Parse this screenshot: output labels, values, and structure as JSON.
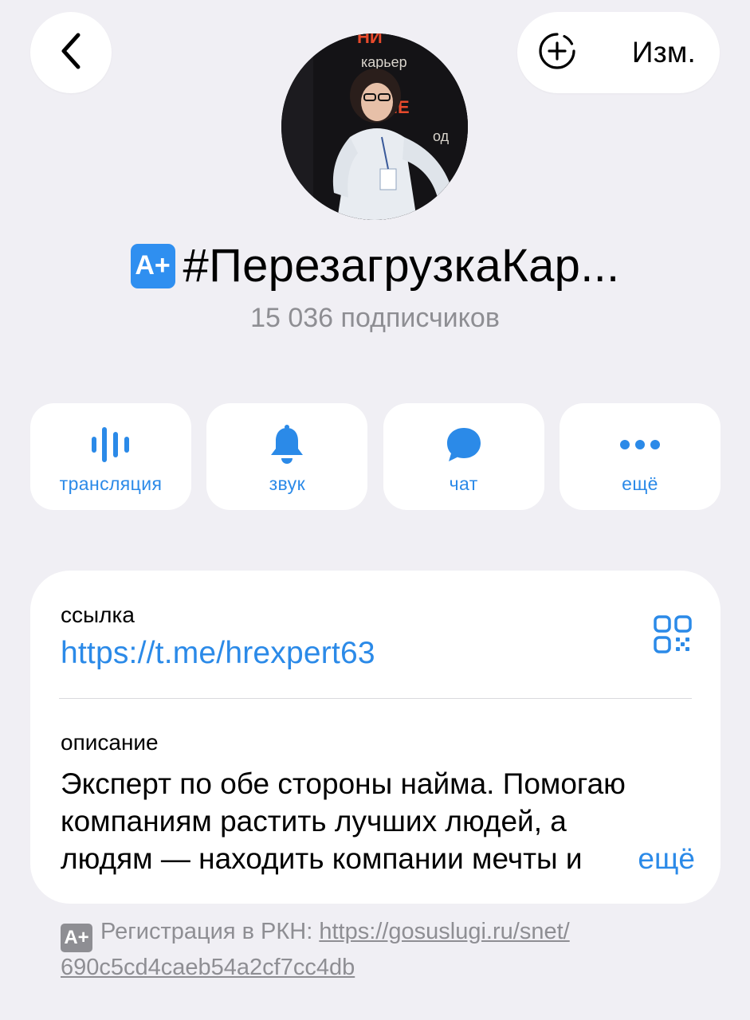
{
  "nav": {
    "back_icon": "chevron-left-icon",
    "add_icon": "circle-plus-icon",
    "edit_label": "Изм."
  },
  "channel": {
    "badge_text": "A+",
    "title": "#ПерезагрузкаКар...",
    "subscribers": "15 036 подписчиков"
  },
  "actions": [
    {
      "label": "трансляция",
      "icon": "live-stream-icon"
    },
    {
      "label": "звук",
      "icon": "bell-icon"
    },
    {
      "label": "чат",
      "icon": "chat-bubble-icon"
    },
    {
      "label": "ещё",
      "icon": "more-dots-icon"
    }
  ],
  "info": {
    "link_label": "ссылка",
    "link_value": "https://t.me/hrexpert63",
    "qr_icon": "qr-code-icon",
    "description_label": "описание",
    "description_lines": [
      "Эксперт по обе стороны найма. Помогаю",
      "компаниям растить лучших людей, а",
      "людям — находить компании мечты и"
    ],
    "more_label": "ещё"
  },
  "footer": {
    "badge_text": "A+",
    "text": "Регистрация в РКН: ",
    "link_line1": "https://gosuslugi.ru/snet/",
    "link_line2": "690c5cd4caeb54a2cf7cc4db"
  },
  "colors": {
    "accent": "#2b8ae8",
    "background": "#f0eff4",
    "secondary_text": "#8e8e93"
  }
}
